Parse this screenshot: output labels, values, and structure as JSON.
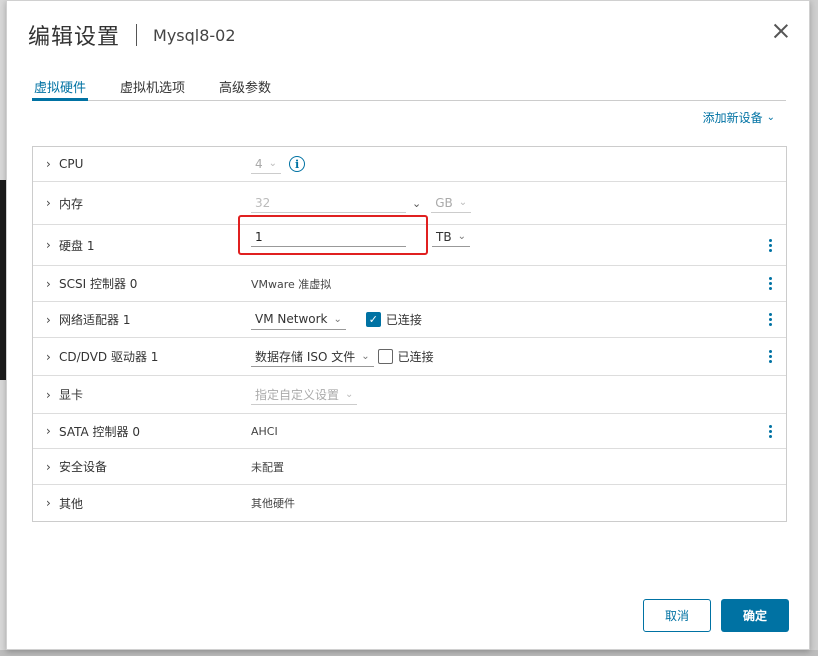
{
  "dialog": {
    "title": "编辑设置",
    "subtitle": "Mysql8-02"
  },
  "tabs": [
    {
      "label": "虚拟硬件",
      "active": true
    },
    {
      "label": "虚拟机选项",
      "active": false
    },
    {
      "label": "高级参数",
      "active": false
    }
  ],
  "add_device": {
    "label": "添加新设备"
  },
  "rows": {
    "cpu": {
      "label": "CPU",
      "value": "4"
    },
    "memory": {
      "label": "内存",
      "value": "32",
      "unit": "GB"
    },
    "disk": {
      "label": "硬盘 1",
      "value": "1",
      "unit": "TB"
    },
    "scsi": {
      "label": "SCSI 控制器 0",
      "value": "VMware 准虚拟"
    },
    "network": {
      "label": "网络适配器 1",
      "value": "VM Network",
      "connected_label": "已连接",
      "connected": true
    },
    "cdrom": {
      "label": "CD/DVD 驱动器 1",
      "value": "数据存储 ISO 文件",
      "connected_label": "已连接",
      "connected": false
    },
    "video": {
      "label": "显卡",
      "value": "指定自定义设置"
    },
    "sata": {
      "label": "SATA 控制器 0",
      "value": "AHCI"
    },
    "security": {
      "label": "安全设备",
      "value": "未配置"
    },
    "other": {
      "label": "其他",
      "value": "其他硬件"
    }
  },
  "buttons": {
    "cancel": "取消",
    "ok": "确定"
  },
  "colors": {
    "accent": "#0072a3",
    "highlight": "#e02020"
  }
}
